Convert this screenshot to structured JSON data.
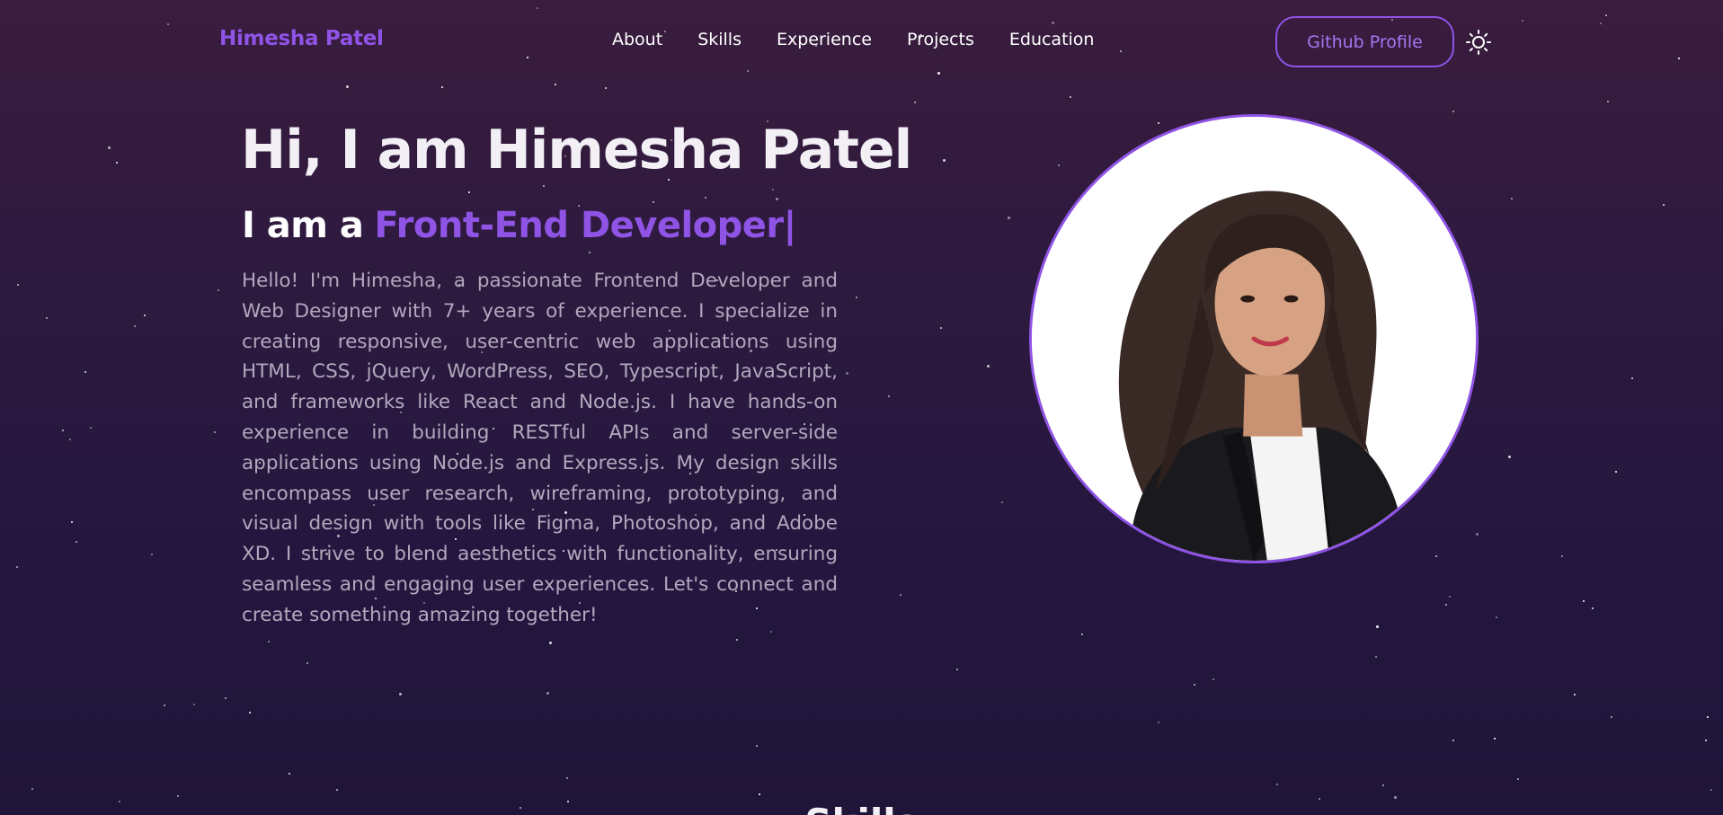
{
  "navbar": {
    "brand": "Himesha Patel",
    "links": [
      {
        "label": "About"
      },
      {
        "label": "Skills"
      },
      {
        "label": "Experience"
      },
      {
        "label": "Projects"
      },
      {
        "label": "Education"
      }
    ],
    "github_button": "Github Profile",
    "theme_toggle_icon": "sun-icon"
  },
  "hero": {
    "title": "Hi, I am Himesha Patel",
    "subtitle_prefix": "I am a",
    "subtitle_role": "Front-End Developer",
    "cursor": "|",
    "description": "Hello! I'm Himesha, a passionate Frontend Developer and Web Designer with 7+ years of experience. I specialize in creating responsive, user-centric web applications using HTML, CSS, jQuery, WordPress, SEO, Typescript, JavaScript, and frameworks like React and Node.js. I have hands-on experience in building RESTful APIs and server-side applications using Node.js and Express.js. My design skills encompass user research, wireframing, prototyping, and visual design with tools like Figma, Photoshop, and Adobe XD. I strive to blend aesthetics with functionality, ensuring seamless and engaging user experiences. Let's connect and create something amazing together!"
  },
  "next_section": {
    "title": "Skills"
  },
  "colors": {
    "accent": "#8f54e6",
    "background_top": "#3a1c3e",
    "background_bottom": "#1f1538",
    "text_primary": "#f2eff5",
    "text_muted": "#b2a8bd"
  }
}
